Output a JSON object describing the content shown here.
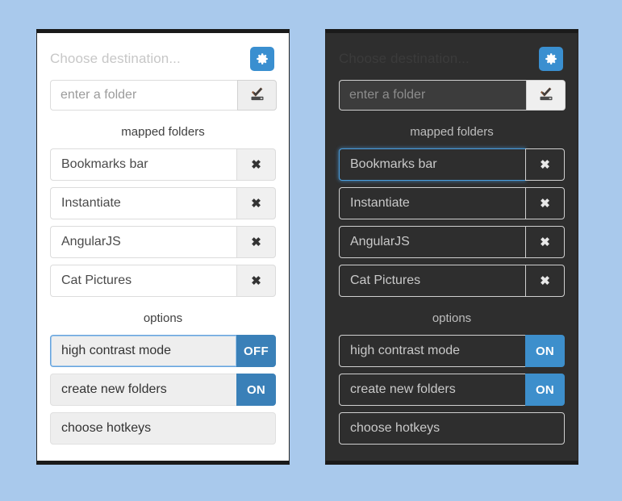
{
  "meta": {
    "background_color": "#a9c9ec",
    "accent_color": "#3a8fd0",
    "toggle_color": "#3a80b8"
  },
  "panels": [
    {
      "theme": "light",
      "header": {
        "title": "Choose destination...",
        "gear_icon": "gear-icon"
      },
      "input": {
        "placeholder": "enter a folder",
        "value": "",
        "submit_icon": "check-submit-icon"
      },
      "mapped_label": "mapped folders",
      "folders": [
        {
          "name": "Bookmarks bar",
          "remove_icon": "close-x-icon",
          "focused": false
        },
        {
          "name": "Instantiate",
          "remove_icon": "close-x-icon",
          "focused": false
        },
        {
          "name": "AngularJS",
          "remove_icon": "close-x-icon",
          "focused": false
        },
        {
          "name": "Cat Pictures",
          "remove_icon": "close-x-icon",
          "focused": false
        }
      ],
      "options_label": "options",
      "options": [
        {
          "label": "high contrast mode",
          "state": "OFF",
          "has_toggle": true,
          "focused": true
        },
        {
          "label": "create new folders",
          "state": "ON",
          "has_toggle": true,
          "focused": false
        },
        {
          "label": "choose hotkeys",
          "state": "",
          "has_toggle": false,
          "focused": false
        }
      ]
    },
    {
      "theme": "dark",
      "header": {
        "title": "Choose destination...",
        "gear_icon": "gear-icon"
      },
      "input": {
        "placeholder": "enter a folder",
        "value": "",
        "submit_icon": "check-submit-icon"
      },
      "mapped_label": "mapped folders",
      "folders": [
        {
          "name": "Bookmarks bar",
          "remove_icon": "close-x-icon",
          "focused": true
        },
        {
          "name": "Instantiate",
          "remove_icon": "close-x-icon",
          "focused": false
        },
        {
          "name": "AngularJS",
          "remove_icon": "close-x-icon",
          "focused": false
        },
        {
          "name": "Cat Pictures",
          "remove_icon": "close-x-icon",
          "focused": false
        }
      ],
      "options_label": "options",
      "options": [
        {
          "label": "high contrast mode",
          "state": "ON",
          "has_toggle": true,
          "focused": false
        },
        {
          "label": "create new folders",
          "state": "ON",
          "has_toggle": true,
          "focused": false
        },
        {
          "label": "choose hotkeys",
          "state": "",
          "has_toggle": false,
          "focused": false
        }
      ]
    }
  ]
}
